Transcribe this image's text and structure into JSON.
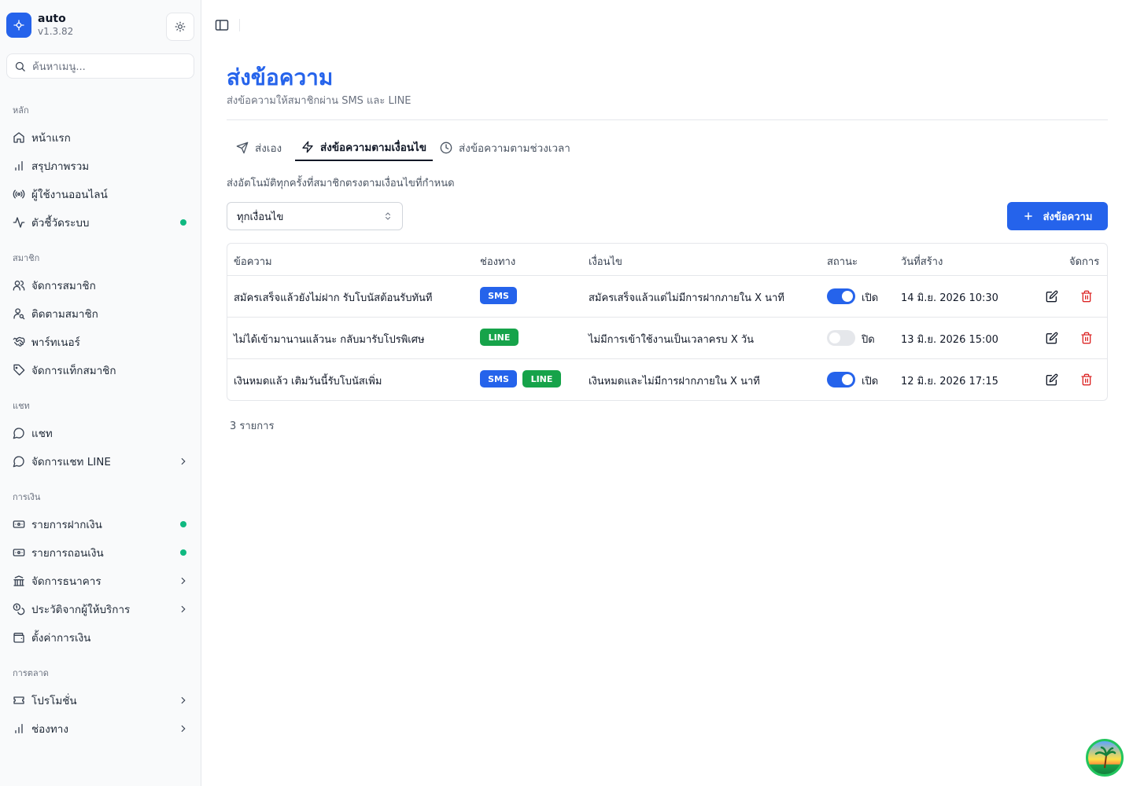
{
  "app": {
    "name": "auto",
    "version": "v1.3.82"
  },
  "icons": {
    "logo": "puzzle-icon",
    "theme": "sun-icon",
    "search": "search-icon",
    "sidebar_toggle": "panel-left-icon"
  },
  "search": {
    "placeholder": "ค้นหาเมนู..."
  },
  "sidebar": {
    "groups": [
      {
        "label": "หลัก",
        "items": [
          {
            "label": "หน้าแรก",
            "icon": "home-icon"
          },
          {
            "label": "สรุปภาพรวม",
            "icon": "bar-chart-icon"
          },
          {
            "label": "ผู้ใช้งานออนไลน์",
            "icon": "radio-icon"
          },
          {
            "label": "ตัวชี้วัดระบบ",
            "icon": "activity-icon",
            "dot": true
          }
        ]
      },
      {
        "label": "สมาชิก",
        "items": [
          {
            "label": "จัดการสมาชิก",
            "icon": "users-icon"
          },
          {
            "label": "ติดตามสมาชิก",
            "icon": "user-search-icon"
          },
          {
            "label": "พาร์ทเนอร์",
            "icon": "handshake-icon"
          },
          {
            "label": "จัดการแท็กสมาชิก",
            "icon": "tag-icon"
          }
        ]
      },
      {
        "label": "แชท",
        "items": [
          {
            "label": "แชท",
            "icon": "message-circle-icon"
          },
          {
            "label": "จัดการแชท LINE",
            "icon": "message-circle-icon",
            "chevron": true
          }
        ]
      },
      {
        "label": "การเงิน",
        "items": [
          {
            "label": "รายการฝากเงิน",
            "icon": "banknote-in-icon",
            "dot": true
          },
          {
            "label": "รายการถอนเงิน",
            "icon": "banknote-out-icon",
            "dot": true
          },
          {
            "label": "จัดการธนาคาร",
            "icon": "bank-icon",
            "chevron": true
          },
          {
            "label": "ประวัติจากผู้ให้บริการ",
            "icon": "coins-icon",
            "chevron": true
          },
          {
            "label": "ตั้งค่าการเงิน",
            "icon": "wallet-icon"
          }
        ]
      },
      {
        "label": "การตลาด",
        "items": [
          {
            "label": "โปรโมชั่น",
            "icon": "ticket-icon",
            "chevron": true
          },
          {
            "label": "ช่องทาง",
            "icon": "bar-chart-icon",
            "chevron": true
          }
        ]
      }
    ]
  },
  "page": {
    "title": "ส่งข้อความ",
    "subtitle": "ส่งข้อความให้สมาชิกผ่าน SMS และ LINE"
  },
  "tabs": [
    {
      "label": "ส่งเอง",
      "icon": "send-icon",
      "active": false
    },
    {
      "label": "ส่งข้อความตามเงื่อนไข",
      "icon": "zap-icon",
      "active": true
    },
    {
      "label": "ส่งข้อความตามช่วงเวลา",
      "icon": "clock-icon",
      "active": false
    }
  ],
  "description": "ส่งอัตโนมัติทุกครั้งที่สมาชิกตรงตามเงื่อนไขที่กำหนด",
  "filter": {
    "selected": "ทุกเงื่อนไข"
  },
  "primary_button": {
    "label": "ส่งข้อความ",
    "icon": "plus-icon"
  },
  "table": {
    "columns": [
      "ข้อความ",
      "ช่องทาง",
      "เงื่อนไข",
      "สถานะ",
      "วันที่สร้าง",
      "จัดการ"
    ],
    "rows": [
      {
        "message": "สมัครเสร็จแล้วยังไม่ฝาก รับโบนัสต้อนรับทันที",
        "channels": [
          "SMS"
        ],
        "condition": "สมัครเสร็จแล้วแต่ไม่มีการฝากภายใน X นาที",
        "enabled": true,
        "status": "เปิด",
        "created": "14 มิ.ย. 2026 10:30"
      },
      {
        "message": "ไม่ได้เข้ามานานแล้วนะ กลับมารับโปรพิเศษ",
        "channels": [
          "LINE"
        ],
        "condition": "ไม่มีการเข้าใช้งานเป็นเวลาครบ X วัน",
        "enabled": false,
        "status": "ปิด",
        "created": "13 มิ.ย. 2026 15:00"
      },
      {
        "message": "เงินหมดแล้ว เติมวันนี้รับโบนัสเพิ่ม",
        "channels": [
          "SMS",
          "LINE"
        ],
        "condition": "เงินหมดและไม่มีการฝากภายใน X นาที",
        "enabled": true,
        "status": "เปิด",
        "created": "12 มิ.ย. 2026 17:15"
      }
    ]
  },
  "footer": {
    "count": "3 รายการ"
  },
  "colors": {
    "primary": "#2563eb",
    "sms": "#2563eb",
    "line": "#16a34a",
    "danger": "#dc2626",
    "online_dot": "#10b981"
  }
}
